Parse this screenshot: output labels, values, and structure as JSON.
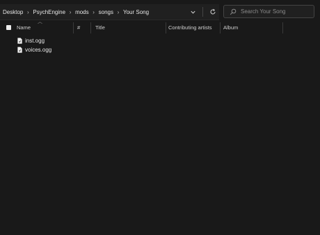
{
  "breadcrumb": {
    "items": [
      "Desktop",
      "PsychEngine",
      "mods",
      "songs",
      "Your Song"
    ],
    "separator": "›"
  },
  "address_actions": {
    "dropdown_icon": "chevron-down-icon",
    "refresh_icon": "refresh-icon"
  },
  "search": {
    "placeholder": "Search Your Song"
  },
  "columns": {
    "name": "Name",
    "number": "#",
    "title": "Title",
    "contributing_artists": "Contributing artists",
    "album": "Album"
  },
  "files": [
    {
      "name": "inst.ogg",
      "icon": "audio-file-icon"
    },
    {
      "name": "voices.ogg",
      "icon": "audio-file-icon"
    }
  ],
  "colors": {
    "background": "#191919",
    "text": "#e6e6e6",
    "muted": "#8a8a8a"
  }
}
